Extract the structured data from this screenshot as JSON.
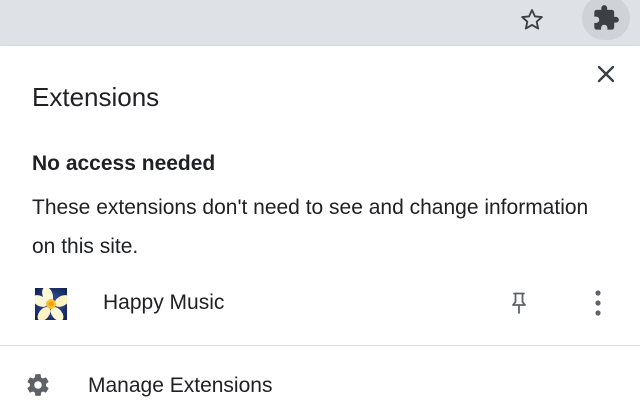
{
  "toolbar": {
    "bookmark_icon": "star-outline-icon",
    "extensions_icon": "puzzle-piece-icon"
  },
  "panel": {
    "title": "Extensions",
    "close_icon": "close-icon",
    "section": {
      "heading": "No access needed",
      "description": "These extensions don't need to see and change information on this site."
    },
    "extensions": [
      {
        "name": "Happy Music",
        "icon": "happy-music-flower-icon",
        "pin_icon": "pin-icon",
        "menu_icon": "more-vertical-icon"
      }
    ],
    "manage": {
      "label": "Manage Extensions",
      "icon": "gear-icon"
    }
  },
  "colors": {
    "toolbar_bg": "#dee1e6",
    "text": "#202124",
    "icon_grey": "#5f6368",
    "divider": "#dadce0"
  }
}
